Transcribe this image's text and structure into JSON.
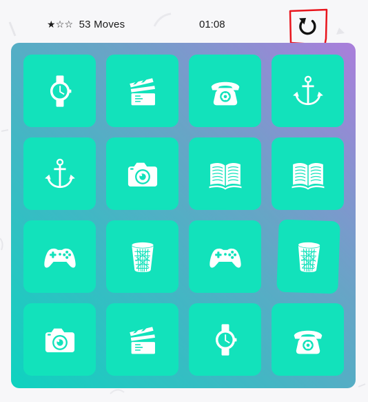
{
  "header": {
    "stars": "★☆☆",
    "moves_count": "53",
    "moves_label": "Moves",
    "timer": "01:08"
  },
  "deck": [
    {
      "icon": "watch-icon"
    },
    {
      "icon": "clapperboard-icon"
    },
    {
      "icon": "telephone-icon"
    },
    {
      "icon": "anchor-icon"
    },
    {
      "icon": "anchor-icon"
    },
    {
      "icon": "camera-icon"
    },
    {
      "icon": "book-icon"
    },
    {
      "icon": "book-icon"
    },
    {
      "icon": "gamepad-icon"
    },
    {
      "icon": "trash-bin-icon"
    },
    {
      "icon": "gamepad-icon"
    },
    {
      "icon": "trash-bin-icon"
    },
    {
      "icon": "camera-icon"
    },
    {
      "icon": "clapperboard-icon"
    },
    {
      "icon": "watch-icon"
    },
    {
      "icon": "telephone-icon"
    }
  ],
  "colors": {
    "card": "#12e2bb",
    "board_gradient_top_right": "#aa7edb",
    "board_gradient_bottom_left": "#0ed3bf",
    "restart_highlight": "#e8141c"
  }
}
